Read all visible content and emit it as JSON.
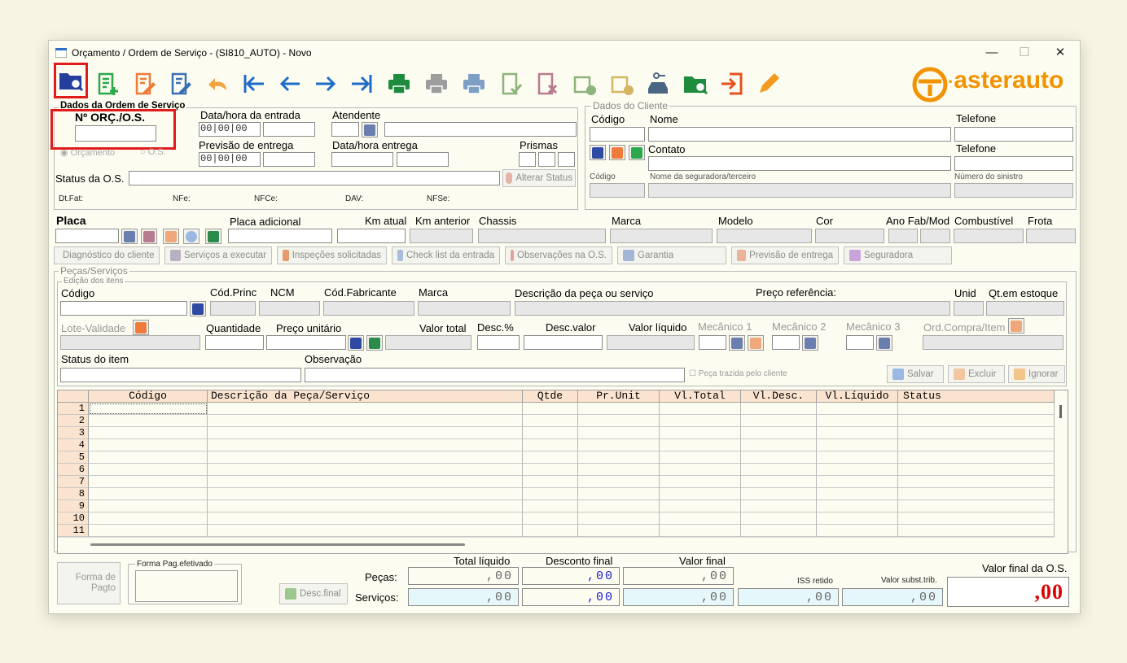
{
  "window": {
    "title": "Orçamento / Ordem de Serviço - (SI810_AUTO) - Novo",
    "minimize": "—",
    "maximize": "☐",
    "close": "✕"
  },
  "toolbar": [
    "search-folder",
    "new-document",
    "edit-document",
    "save-document",
    "undo",
    "first",
    "previous",
    "next",
    "last",
    "print-green",
    "print-gray",
    "print-blue",
    "approve",
    "cancel",
    "add-money",
    "edit-money",
    "car-key",
    "search-green-folder",
    "exit",
    "pencil"
  ],
  "brand": {
    "name": "asterauto",
    "color": "#f39200"
  },
  "os_group": {
    "title": "Dados da Ordem de Serviço",
    "numero_label": "Nº ORÇ./O.S.",
    "radio_orcamento": "Orçamento",
    "radio_os": "O.S.",
    "entrada_label": "Data/hora da entrada",
    "atendente_label": "Atendente",
    "previsao_label": "Previsão de entrega",
    "data_hora_entrega_label": "Data/hora entrega",
    "prismas_label": "Prismas",
    "date_placeholder": "00",
    "status_label": "Status da O.S.",
    "alterar_status": "Alterar Status",
    "dt_fat": "Dt.Fat:",
    "nfe": "NFe:",
    "nfce": "NFCe:",
    "dav": "DAV:",
    "nfse": "NFSe:"
  },
  "cliente_group": {
    "title": "Dados do Cliente",
    "codigo": "Código",
    "nome": "Nome",
    "telefone1": "Telefone",
    "contato": "Contato",
    "telefone2": "Telefone",
    "codigo_seg": "Código",
    "nome_seg": "Nome da seguradora/terceiro",
    "sinistro": "Número do sinistro"
  },
  "veiculo": {
    "placa": "Placa",
    "placa_adicional": "Placa adicional",
    "km_atual": "Km atual",
    "km_anterior": "Km anterior",
    "chassis": "Chassis",
    "marca": "Marca",
    "modelo": "Modelo",
    "cor": "Cor",
    "ano": "Ano Fab/Mod",
    "combustivel": "Combustível",
    "frota": "Frota"
  },
  "tabs": [
    "Diagnóstico do cliente",
    "Serviços a executar",
    "Inspeções solicitadas",
    "Check list da entrada",
    "Observações na O.S.",
    "Garantia",
    "Previsão de entrega",
    "Seguradora"
  ],
  "pecas": {
    "group_title": "Peças/Serviços",
    "edicao_title": "Edição dos itens",
    "codigo": "Código",
    "cod_princ": "Cód.Princ",
    "ncm": "NCM",
    "cod_fab": "Cód.Fabricante",
    "marca": "Marca",
    "descricao": "Descrição da peça ou serviço",
    "preco_ref": "Preço referência:",
    "unid": "Unid",
    "qt_estoque": "Qt.em estoque",
    "lote": "Lote-Validade",
    "quantidade": "Quantidade",
    "preco_unit": "Preço unitário",
    "valor_total": "Valor total",
    "desc_pct": "Desc.%",
    "desc_valor": "Desc.valor",
    "valor_liquido": "Valor líquido",
    "mec1": "Mecânico 1",
    "mec2": "Mecânico 2",
    "mec3": "Mecânico 3",
    "ord_compra": "Ord.Compra/Item",
    "status_item": "Status do item",
    "observacao": "Observação",
    "peca_trazida": "Peça trazida pelo cliente",
    "salvar": "Salvar",
    "excluir": "Excluir",
    "ignorar": "Ignorar"
  },
  "grid": {
    "columns": [
      "Código",
      "Descrição da Peça/Serviço",
      "Qtde",
      "Pr.Unit",
      "Vl.Total",
      "Vl.Desc.",
      "Vl.Líquido",
      "Status"
    ],
    "rows": [
      "1",
      "2",
      "3",
      "4",
      "5",
      "6",
      "7",
      "8",
      "9",
      "10",
      "11"
    ]
  },
  "footer": {
    "forma_pagto": "Forma de Pagto",
    "forma_pag_efetivado": "Forma Pag.efetivado",
    "desc_final_btn": "Desc.final",
    "total_liquido": "Total líquido",
    "desconto_final": "Desconto final",
    "valor_final": "Valor final",
    "pecas": "Peças:",
    "servicos": "Serviços:",
    "iss_retido": "ISS retido",
    "valor_subst": "Valor subst.trib.",
    "valor_final_os": "Valor final da O.S.",
    "pecas_total": ",00",
    "pecas_desconto": ",00",
    "pecas_final": ",00",
    "serv_total": ",00",
    "serv_desconto": ",00",
    "serv_final": ",00",
    "iss": ",00",
    "subst": ",00",
    "valor_os": ",00"
  }
}
